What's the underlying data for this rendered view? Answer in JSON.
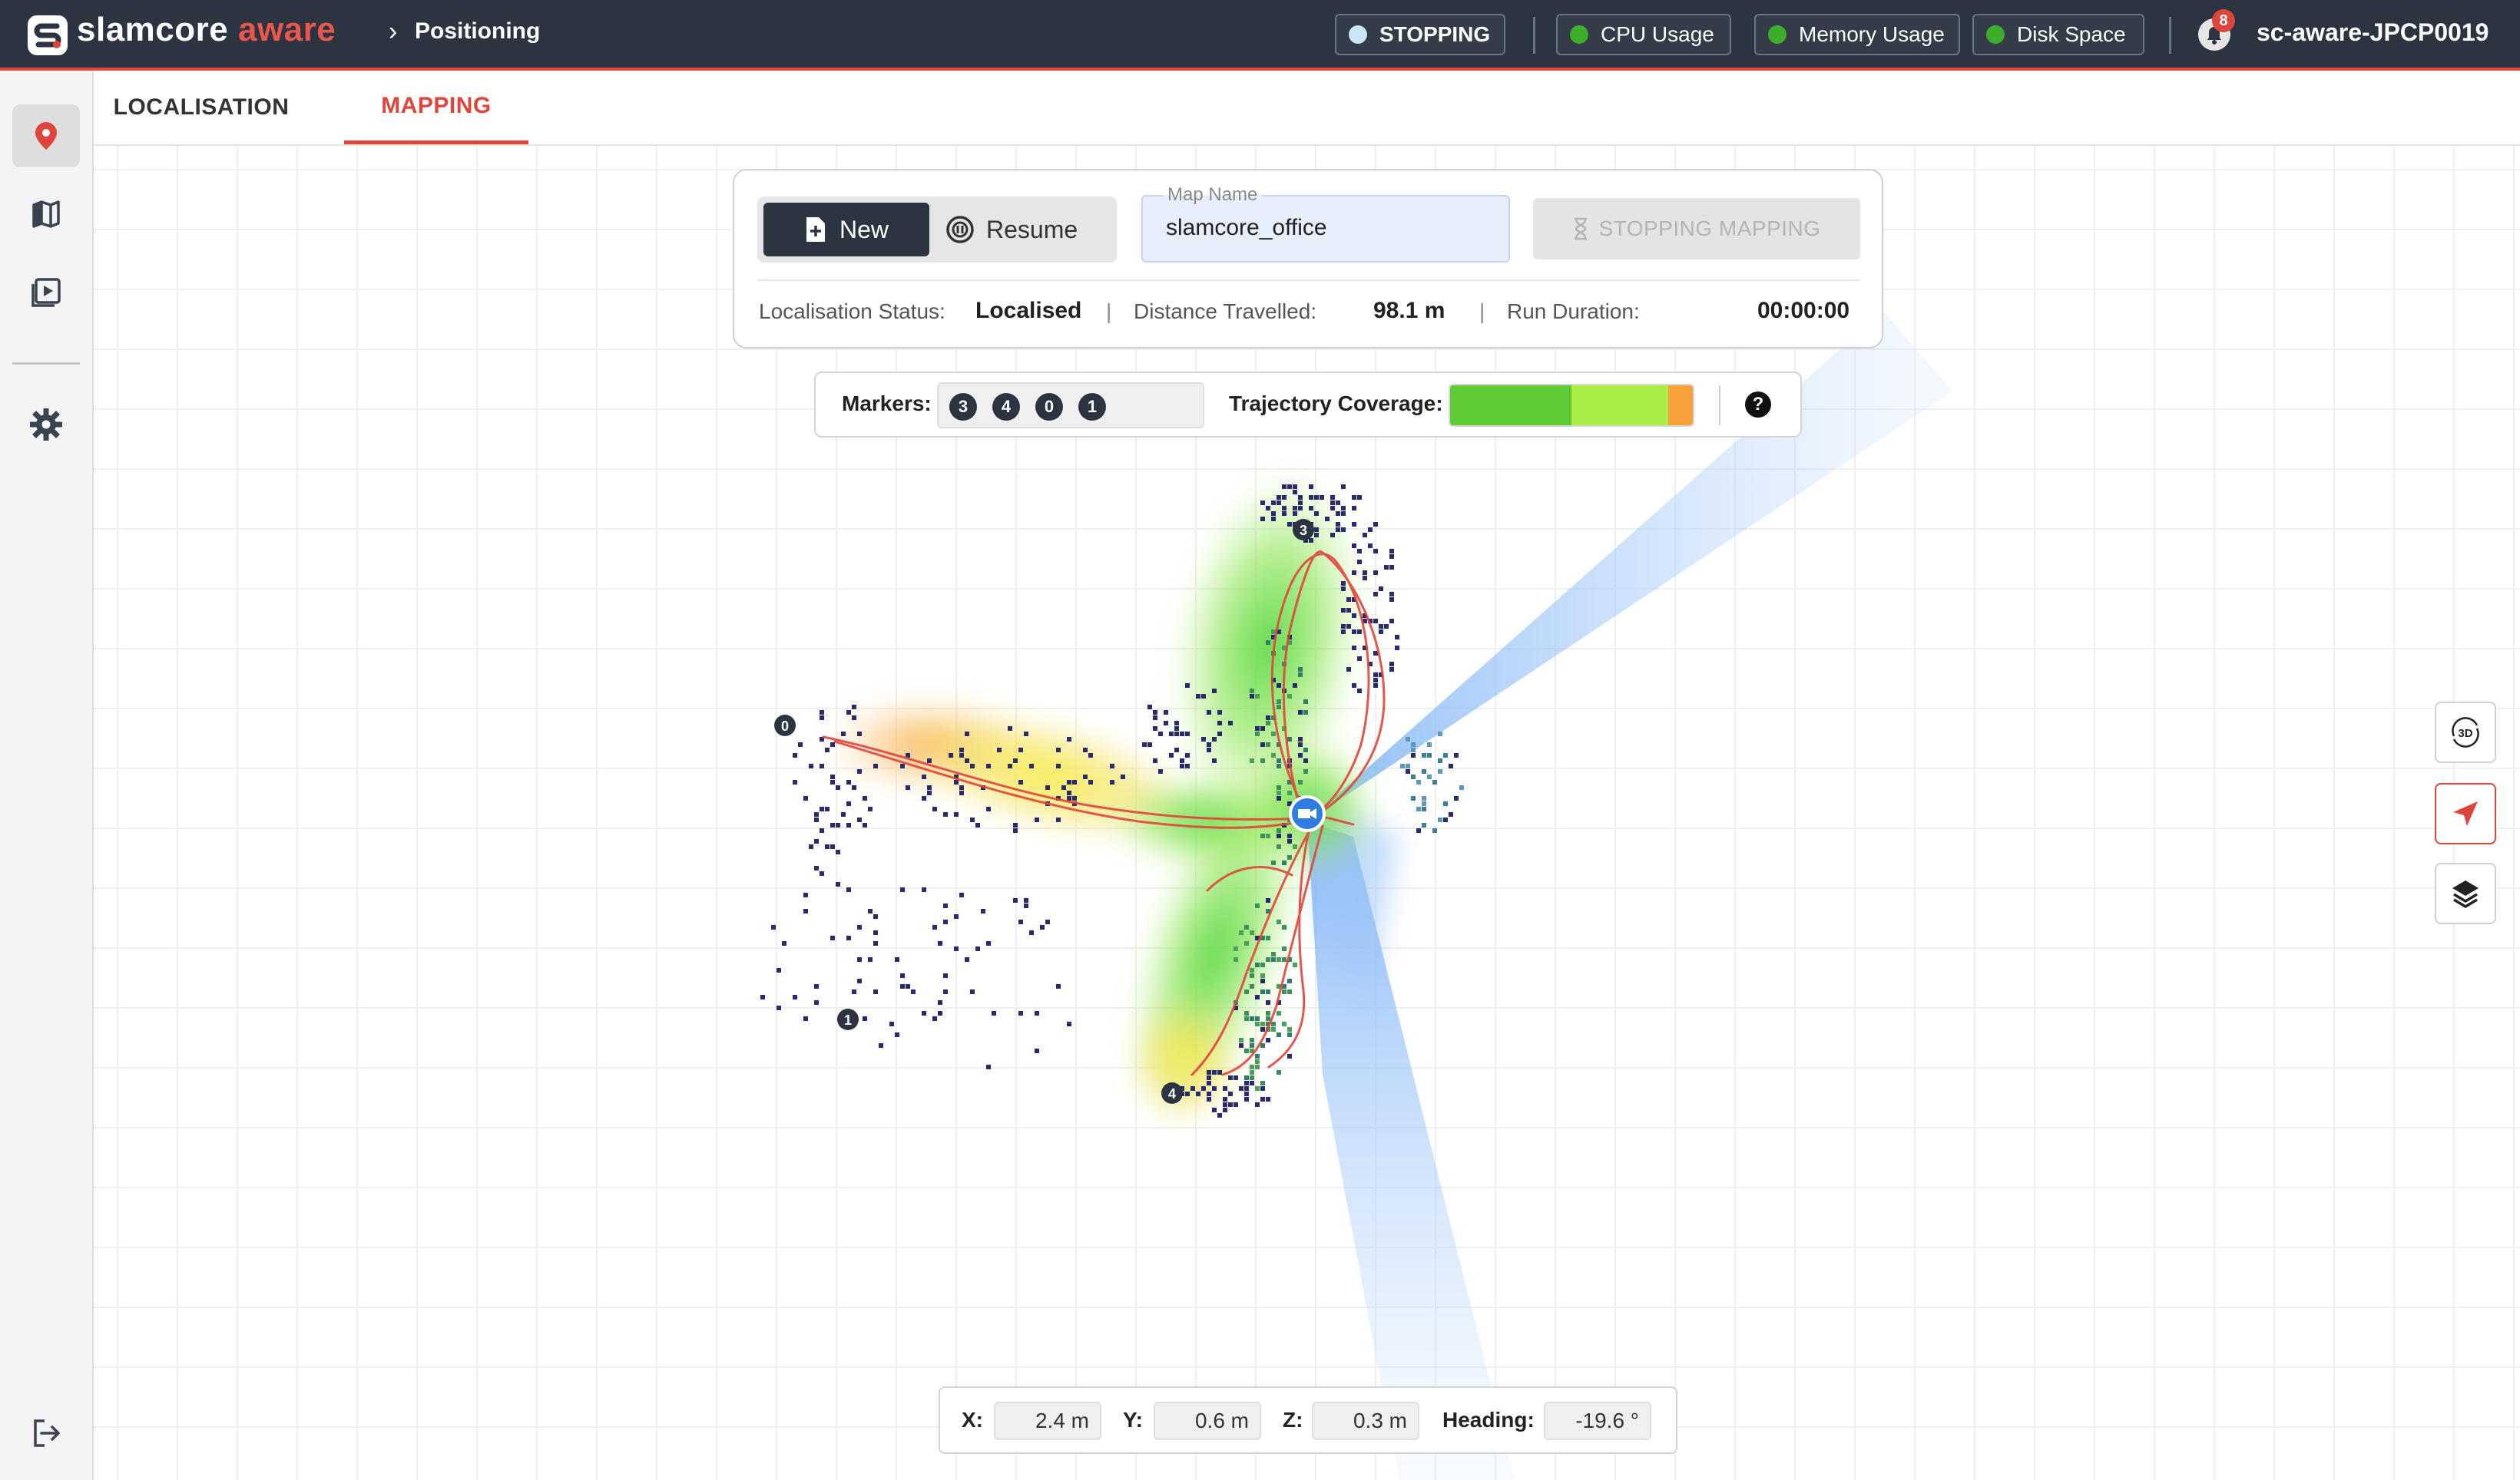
{
  "app": {
    "brand_main": "slamcore",
    "brand_accent": "aware",
    "breadcrumb_sep": "›",
    "breadcrumb": "Positioning"
  },
  "topbar": {
    "status_label": "STOPPING",
    "status_color": "#c9e6f7",
    "cpu_label": "CPU Usage",
    "memory_label": "Memory Usage",
    "disk_label": "Disk Space",
    "health_color": "#3cae2a",
    "notification_count": "8",
    "device_name": "sc-aware-JPCP0019"
  },
  "sidebar": {
    "items": [
      {
        "icon": "map-pin-icon",
        "active": true
      },
      {
        "icon": "map-icon",
        "active": false
      },
      {
        "icon": "playback-icon",
        "active": false
      },
      {
        "icon": "gear-icon",
        "active": false
      },
      {
        "icon": "logout-icon",
        "active": false
      }
    ]
  },
  "tabs": [
    {
      "label": "LOCALISATION",
      "active": false
    },
    {
      "label": "MAPPING",
      "active": true
    }
  ],
  "mapping": {
    "new_label": "New",
    "resume_label": "Resume",
    "map_name_label": "Map Name",
    "map_name_value": "slamcore_office",
    "stop_label": "STOPPING MAPPING",
    "localisation_status_label": "Localisation Status:",
    "localisation_status_value": "Localised",
    "distance_label": "Distance Travelled:",
    "distance_value": "98.1 m",
    "run_duration_label": "Run Duration:",
    "run_duration_value": "00:00:00"
  },
  "markers": {
    "label": "Markers:",
    "ids": [
      "3",
      "4",
      "0",
      "1"
    ],
    "trajectory_label": "Trajectory Coverage:",
    "help_label": "?",
    "coverage_segments": [
      {
        "fraction": 0.5,
        "color": "#5ecb34"
      },
      {
        "fraction": 0.4,
        "color": "#a9ee45"
      },
      {
        "fraction": 0.1,
        "color": "#f7a23a"
      }
    ]
  },
  "map_markers": [
    "3",
    "0",
    "1",
    "4"
  ],
  "tools": {
    "view_3d_label": "3D"
  },
  "coords": {
    "x_label": "X:",
    "x_value": "2.4 m",
    "y_label": "Y:",
    "y_value": "0.6 m",
    "z_label": "Z:",
    "z_value": "0.3 m",
    "heading_label": "Heading:",
    "heading_value": "-19.6 °"
  },
  "colors": {
    "accent": "#e0453c",
    "topbar_bg": "#2b3440",
    "trajectory": "#e0453c",
    "robot": "#2f7de1",
    "point_cloud": "#2a2a6e"
  }
}
